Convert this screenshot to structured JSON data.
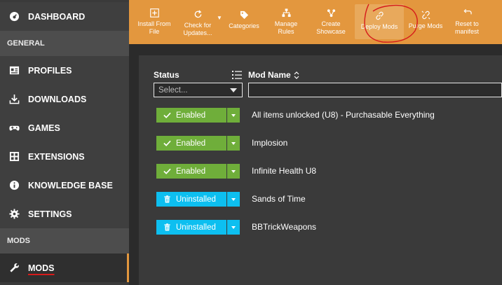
{
  "sidebar": {
    "items": [
      {
        "label": "DASHBOARD",
        "icon": "dashboard-icon"
      },
      {
        "label": "PROFILES",
        "icon": "profiles-icon"
      },
      {
        "label": "DOWNLOADS",
        "icon": "download-icon"
      },
      {
        "label": "GAMES",
        "icon": "gamepad-icon"
      },
      {
        "label": "EXTENSIONS",
        "icon": "extensions-icon"
      },
      {
        "label": "KNOWLEDGE BASE",
        "icon": "info-icon"
      },
      {
        "label": "SETTINGS",
        "icon": "gear-icon"
      },
      {
        "label": "MODS",
        "icon": "wrench-icon"
      }
    ],
    "sections": {
      "general": "GENERAL",
      "mods": "MODS"
    }
  },
  "toolbar": {
    "buttons": [
      {
        "line1": "Install From",
        "line2": "File",
        "icon": "install-icon"
      },
      {
        "line1": "Check for",
        "line2": "Updates...",
        "icon": "refresh-icon"
      },
      {
        "line1": "Categories",
        "line2": "",
        "icon": "tag-icon"
      },
      {
        "line1": "Manage",
        "line2": "Rules",
        "icon": "rules-icon"
      },
      {
        "line1": "Create",
        "line2": "Showcase",
        "icon": "showcase-icon"
      },
      {
        "line1": "Deploy Mods",
        "line2": "",
        "icon": "link-icon"
      },
      {
        "line1": "Purge Mods",
        "line2": "",
        "icon": "unlink-icon"
      },
      {
        "line1": "Reset to",
        "line2": "manifest",
        "icon": "undo-icon"
      }
    ]
  },
  "table": {
    "status_header": "Status",
    "name_header": "Mod Name",
    "status_placeholder": "Select...",
    "rows": [
      {
        "status": "Enabled",
        "name": "All items unlocked (U8) - Purchasable Everything"
      },
      {
        "status": "Enabled",
        "name": "Implosion"
      },
      {
        "status": "Enabled",
        "name": "Infinite Health U8"
      },
      {
        "status": "Uninstalled",
        "name": "Sands of Time"
      },
      {
        "status": "Uninstalled",
        "name": "BBTrickWeapons"
      }
    ]
  },
  "colors": {
    "accent": "#e3973e",
    "enabled": "#6fae3a",
    "uninstalled": "#0dbff0",
    "annotation": "#d61b1b"
  }
}
